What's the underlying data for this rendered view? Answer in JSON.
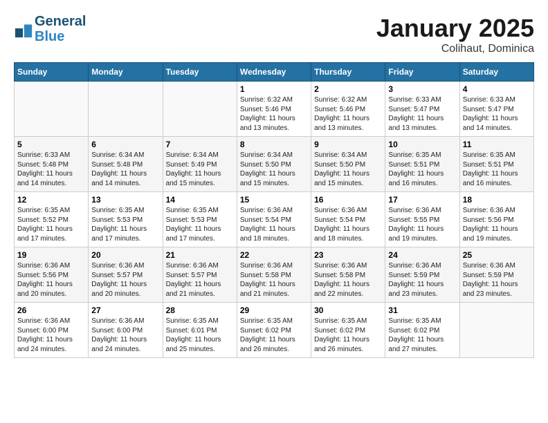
{
  "header": {
    "logo_line1": "General",
    "logo_line2": "Blue",
    "month_title": "January 2025",
    "location": "Colihaut, Dominica"
  },
  "days_of_week": [
    "Sunday",
    "Monday",
    "Tuesday",
    "Wednesday",
    "Thursday",
    "Friday",
    "Saturday"
  ],
  "weeks": [
    [
      {
        "day": "",
        "info": ""
      },
      {
        "day": "",
        "info": ""
      },
      {
        "day": "",
        "info": ""
      },
      {
        "day": "1",
        "info": "Sunrise: 6:32 AM\nSunset: 5:46 PM\nDaylight: 11 hours\nand 13 minutes."
      },
      {
        "day": "2",
        "info": "Sunrise: 6:32 AM\nSunset: 5:46 PM\nDaylight: 11 hours\nand 13 minutes."
      },
      {
        "day": "3",
        "info": "Sunrise: 6:33 AM\nSunset: 5:47 PM\nDaylight: 11 hours\nand 13 minutes."
      },
      {
        "day": "4",
        "info": "Sunrise: 6:33 AM\nSunset: 5:47 PM\nDaylight: 11 hours\nand 14 minutes."
      }
    ],
    [
      {
        "day": "5",
        "info": "Sunrise: 6:33 AM\nSunset: 5:48 PM\nDaylight: 11 hours\nand 14 minutes."
      },
      {
        "day": "6",
        "info": "Sunrise: 6:34 AM\nSunset: 5:48 PM\nDaylight: 11 hours\nand 14 minutes."
      },
      {
        "day": "7",
        "info": "Sunrise: 6:34 AM\nSunset: 5:49 PM\nDaylight: 11 hours\nand 15 minutes."
      },
      {
        "day": "8",
        "info": "Sunrise: 6:34 AM\nSunset: 5:50 PM\nDaylight: 11 hours\nand 15 minutes."
      },
      {
        "day": "9",
        "info": "Sunrise: 6:34 AM\nSunset: 5:50 PM\nDaylight: 11 hours\nand 15 minutes."
      },
      {
        "day": "10",
        "info": "Sunrise: 6:35 AM\nSunset: 5:51 PM\nDaylight: 11 hours\nand 16 minutes."
      },
      {
        "day": "11",
        "info": "Sunrise: 6:35 AM\nSunset: 5:51 PM\nDaylight: 11 hours\nand 16 minutes."
      }
    ],
    [
      {
        "day": "12",
        "info": "Sunrise: 6:35 AM\nSunset: 5:52 PM\nDaylight: 11 hours\nand 17 minutes."
      },
      {
        "day": "13",
        "info": "Sunrise: 6:35 AM\nSunset: 5:53 PM\nDaylight: 11 hours\nand 17 minutes."
      },
      {
        "day": "14",
        "info": "Sunrise: 6:35 AM\nSunset: 5:53 PM\nDaylight: 11 hours\nand 17 minutes."
      },
      {
        "day": "15",
        "info": "Sunrise: 6:36 AM\nSunset: 5:54 PM\nDaylight: 11 hours\nand 18 minutes."
      },
      {
        "day": "16",
        "info": "Sunrise: 6:36 AM\nSunset: 5:54 PM\nDaylight: 11 hours\nand 18 minutes."
      },
      {
        "day": "17",
        "info": "Sunrise: 6:36 AM\nSunset: 5:55 PM\nDaylight: 11 hours\nand 19 minutes."
      },
      {
        "day": "18",
        "info": "Sunrise: 6:36 AM\nSunset: 5:56 PM\nDaylight: 11 hours\nand 19 minutes."
      }
    ],
    [
      {
        "day": "19",
        "info": "Sunrise: 6:36 AM\nSunset: 5:56 PM\nDaylight: 11 hours\nand 20 minutes."
      },
      {
        "day": "20",
        "info": "Sunrise: 6:36 AM\nSunset: 5:57 PM\nDaylight: 11 hours\nand 20 minutes."
      },
      {
        "day": "21",
        "info": "Sunrise: 6:36 AM\nSunset: 5:57 PM\nDaylight: 11 hours\nand 21 minutes."
      },
      {
        "day": "22",
        "info": "Sunrise: 6:36 AM\nSunset: 5:58 PM\nDaylight: 11 hours\nand 21 minutes."
      },
      {
        "day": "23",
        "info": "Sunrise: 6:36 AM\nSunset: 5:58 PM\nDaylight: 11 hours\nand 22 minutes."
      },
      {
        "day": "24",
        "info": "Sunrise: 6:36 AM\nSunset: 5:59 PM\nDaylight: 11 hours\nand 23 minutes."
      },
      {
        "day": "25",
        "info": "Sunrise: 6:36 AM\nSunset: 5:59 PM\nDaylight: 11 hours\nand 23 minutes."
      }
    ],
    [
      {
        "day": "26",
        "info": "Sunrise: 6:36 AM\nSunset: 6:00 PM\nDaylight: 11 hours\nand 24 minutes."
      },
      {
        "day": "27",
        "info": "Sunrise: 6:36 AM\nSunset: 6:00 PM\nDaylight: 11 hours\nand 24 minutes."
      },
      {
        "day": "28",
        "info": "Sunrise: 6:35 AM\nSunset: 6:01 PM\nDaylight: 11 hours\nand 25 minutes."
      },
      {
        "day": "29",
        "info": "Sunrise: 6:35 AM\nSunset: 6:02 PM\nDaylight: 11 hours\nand 26 minutes."
      },
      {
        "day": "30",
        "info": "Sunrise: 6:35 AM\nSunset: 6:02 PM\nDaylight: 11 hours\nand 26 minutes."
      },
      {
        "day": "31",
        "info": "Sunrise: 6:35 AM\nSunset: 6:02 PM\nDaylight: 11 hours\nand 27 minutes."
      },
      {
        "day": "",
        "info": ""
      }
    ]
  ]
}
